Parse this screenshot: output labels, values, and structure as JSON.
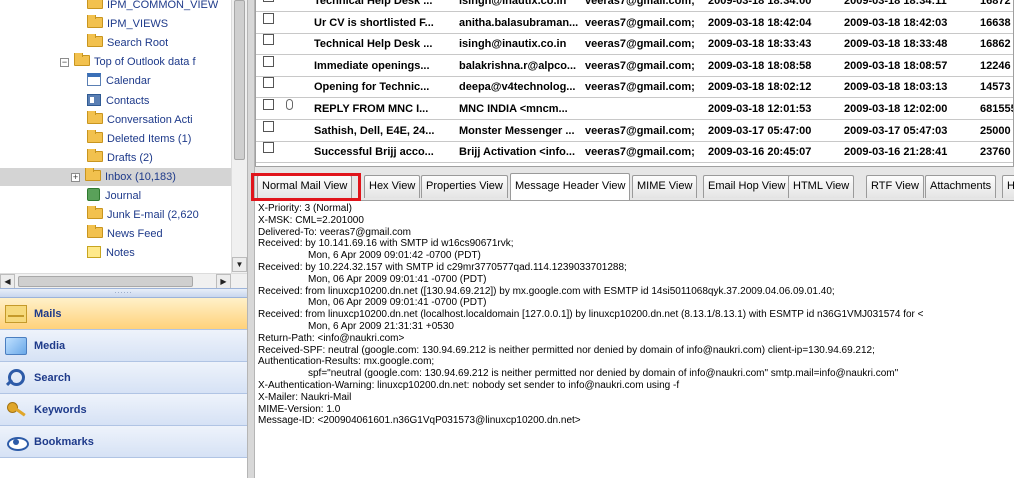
{
  "tree": {
    "items": [
      {
        "label": "IPM_COMMON_VIEW",
        "icon": "folder-icon"
      },
      {
        "label": "IPM_VIEWS",
        "icon": "folder-icon"
      },
      {
        "label": "Search Root",
        "icon": "folder-icon"
      },
      {
        "label": "Top of Outlook data f",
        "icon": "folder-icon",
        "expander": "⊟"
      },
      {
        "label": "Calendar",
        "icon": "calendar-icon"
      },
      {
        "label": "Contacts",
        "icon": "contacts-icon"
      },
      {
        "label": "Conversation Acti",
        "icon": "folder-icon"
      },
      {
        "label": "Deleted Items  (1)",
        "icon": "folder-icon"
      },
      {
        "label": "Drafts  (2)",
        "icon": "folder-icon"
      },
      {
        "label": "Inbox  (10,183)",
        "icon": "folder-icon",
        "expander": "⊞"
      },
      {
        "label": "Journal",
        "icon": "journal-icon"
      },
      {
        "label": "Junk E-mail  (2,620",
        "icon": "folder-icon"
      },
      {
        "label": "News Feed",
        "icon": "folder-icon"
      },
      {
        "label": "Notes",
        "icon": "notes-icon"
      }
    ],
    "selected_index": 9
  },
  "nav": {
    "grip": "......",
    "items": [
      {
        "label": "Mails",
        "icon": "mail-icon",
        "active": true
      },
      {
        "label": "Media",
        "icon": "media-icon",
        "active": false
      },
      {
        "label": "Search",
        "icon": "search-icon",
        "active": false
      },
      {
        "label": "Keywords",
        "icon": "key-icon",
        "active": false
      },
      {
        "label": "Bookmarks",
        "icon": "eye-icon",
        "active": false
      }
    ]
  },
  "messages": [
    {
      "subject": "Technical Help Desk ...",
      "from": "isingh@inautix.co.in",
      "to": "veeras7@gmail.com;",
      "sent": "2009-03-18 18:34:00",
      "received": "2009-03-18 18:34:11",
      "size": "16872",
      "attachment": false
    },
    {
      "subject": "Ur CV is shortlisted F...",
      "from": "anitha.balasubraman...",
      "to": "veeras7@gmail.com;",
      "sent": "2009-03-18 18:42:04",
      "received": "2009-03-18 18:42:03",
      "size": "16638",
      "attachment": false
    },
    {
      "subject": "Technical Help Desk ...",
      "from": "isingh@inautix.co.in",
      "to": "veeras7@gmail.com;",
      "sent": "2009-03-18 18:33:43",
      "received": "2009-03-18 18:33:48",
      "size": "16862",
      "attachment": false
    },
    {
      "subject": "Immediate openings...",
      "from": "balakrishna.r@alpco...",
      "to": "veeras7@gmail.com;",
      "sent": "2009-03-18 18:08:58",
      "received": "2009-03-18 18:08:57",
      "size": "12246",
      "attachment": false
    },
    {
      "subject": "Opening for Technic...",
      "from": "deepa@v4technolog...",
      "to": "veeras7@gmail.com;",
      "sent": "2009-03-18 18:02:12",
      "received": "2009-03-18 18:03:13",
      "size": "14573",
      "attachment": false
    },
    {
      "subject": "REPLY FROM MNC I...",
      "from": "MNC INDIA <mncm...",
      "to": "",
      "sent": "2009-03-18 12:01:53",
      "received": "2009-03-18 12:02:00",
      "size": "681555",
      "attachment": true
    },
    {
      "subject": "Sathish, Dell, E4E, 24...",
      "from": "Monster Messenger ...",
      "to": "veeras7@gmail.com;",
      "sent": "2009-03-17 05:47:00",
      "received": "2009-03-17 05:47:03",
      "size": "25000",
      "attachment": false
    },
    {
      "subject": "Successful Brijj acco...",
      "from": "Brijj Activation <info...",
      "to": "veeras7@gmail.com;",
      "sent": "2009-03-16 20:45:07",
      "received": "2009-03-16 21:28:41",
      "size": "23760",
      "attachment": false
    }
  ],
  "tabs": [
    {
      "label": "Normal Mail View",
      "active": false
    },
    {
      "label": "Hex View",
      "active": false
    },
    {
      "label": "Properties View",
      "active": false
    },
    {
      "label": "Message Header View",
      "active": true
    },
    {
      "label": "MIME View",
      "active": false
    },
    {
      "label": "Email Hop View",
      "active": false
    },
    {
      "label": "HTML View",
      "active": false
    },
    {
      "label": "RTF View",
      "active": false
    },
    {
      "label": "Attachments",
      "active": false
    },
    {
      "label": "H",
      "active": false
    }
  ],
  "highlight_color": "#e0141b",
  "header_lines": [
    {
      "text": "X-Priority: 3 (Normal)",
      "indent": false
    },
    {
      "text": "X-MSK: CML=2.201000",
      "indent": false
    },
    {
      "text": "Delivered-To: veeras7@gmail.com",
      "indent": false
    },
    {
      "text": "Received: by 10.141.69.16 with SMTP id w16cs90671rvk;",
      "indent": false
    },
    {
      "text": "Mon, 6 Apr 2009 09:01:42 -0700 (PDT)",
      "indent": true
    },
    {
      "text": "Received: by 10.224.32.157 with SMTP id c29mr3770577qad.114.1239033701288;",
      "indent": false
    },
    {
      "text": "Mon, 06 Apr 2009 09:01:41 -0700 (PDT)",
      "indent": true
    },
    {
      "text": "Received: from linuxcp10200.dn.net ([130.94.69.212]) by mx.google.com with ESMTP id 14si5011068qyk.37.2009.04.06.09.01.40;",
      "indent": false
    },
    {
      "text": "Mon, 06 Apr 2009 09:01:41 -0700 (PDT)",
      "indent": true
    },
    {
      "text": "Received: from linuxcp10200.dn.net (localhost.localdomain [127.0.0.1]) by linuxcp10200.dn.net (8.13.1/8.13.1) with ESMTP id n36G1VMJ031574 for <",
      "indent": false
    },
    {
      "text": "Mon, 6 Apr 2009 21:31:31 +0530",
      "indent": true
    },
    {
      "text": "Return-Path: <info@naukri.com>",
      "indent": false
    },
    {
      "text": "Received-SPF: neutral (google.com: 130.94.69.212 is neither permitted nor denied by domain of info@naukri.com) client-ip=130.94.69.212;",
      "indent": false
    },
    {
      "text": "Authentication-Results: mx.google.com;",
      "indent": false
    },
    {
      "text": "spf=\"neutral (google.com: 130.94.69.212 is neither permitted nor denied by domain of info@naukri.com\" smtp.mail=info@naukri.com\"",
      "indent": true
    },
    {
      "text": "X-Authentication-Warning: linuxcp10200.dn.net: nobody set sender to info@naukri.com using -f",
      "indent": false
    },
    {
      "text": "X-Mailer: Naukri-Mail",
      "indent": false
    },
    {
      "text": "MIME-Version: 1.0",
      "indent": false
    },
    {
      "text": "Message-ID: <200904061601.n36G1VqP031573@linuxcp10200.dn.net>",
      "indent": false
    }
  ]
}
